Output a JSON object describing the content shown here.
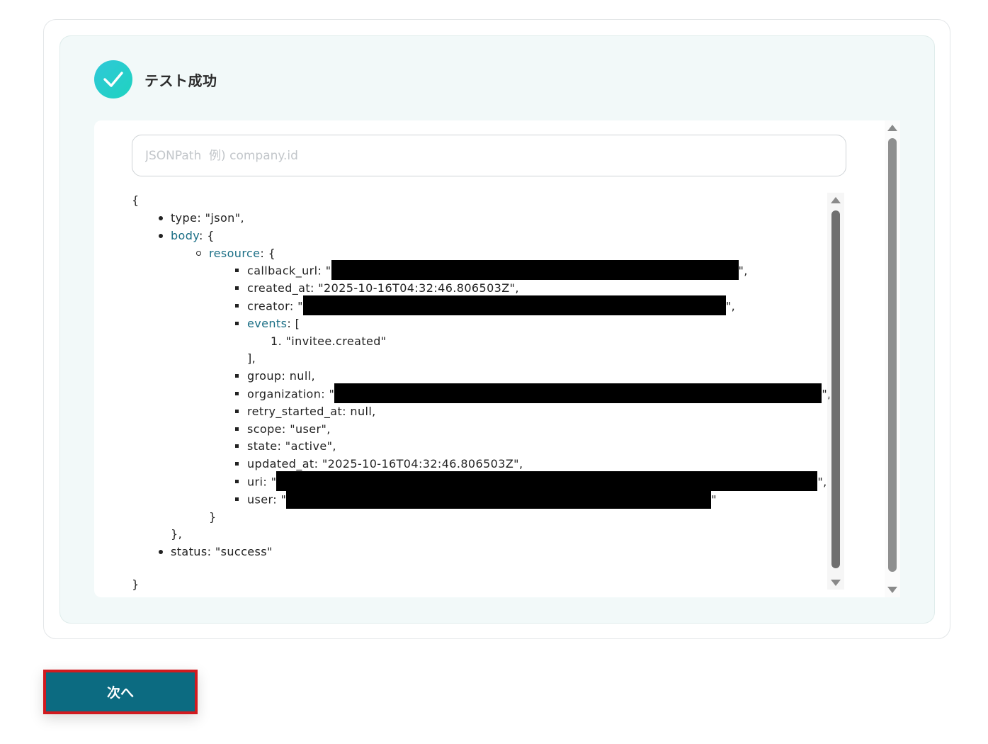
{
  "status": {
    "title": "テスト成功",
    "icon": "check-circle-icon",
    "color": "#2fc8d8"
  },
  "jsonpath": {
    "placeholder": "JSONPath  例) company.id",
    "value": ""
  },
  "tree": {
    "open_brace": "{",
    "type_line": "type: \"json\",",
    "body_key": "body",
    "body_suffix": ": {",
    "resource_key": "resource",
    "resource_suffix": ": {",
    "callback_prefix": "callback_url: \"",
    "callback_suffix": "\",",
    "created_at_line": "created_at: \"2025-10-16T04:32:46.806503Z\",",
    "creator_prefix": "creator: \"",
    "creator_suffix": "\",",
    "events_key": "events",
    "events_suffix": ": [",
    "event_item": "1. \"invitee.created\"",
    "events_close": "],",
    "group_line": "group: null,",
    "organization_prefix": "organization: \"",
    "organization_suffix": "\",",
    "retry_line": "retry_started_at: null,",
    "scope_line": "scope: \"user\",",
    "state_line": "state: \"active\",",
    "updated_at_line": "updated_at: \"2025-10-16T04:32:46.806503Z\",",
    "uri_prefix": "uri: \"",
    "uri_suffix": "\",",
    "user_prefix": "user: \"",
    "user_suffix": "\"",
    "resource_close": "}",
    "body_close": "},",
    "status_line": "status: \"success\"",
    "close_brace": "}"
  },
  "next_button": {
    "label": "次へ",
    "highlight_color": "#d11a1f"
  }
}
